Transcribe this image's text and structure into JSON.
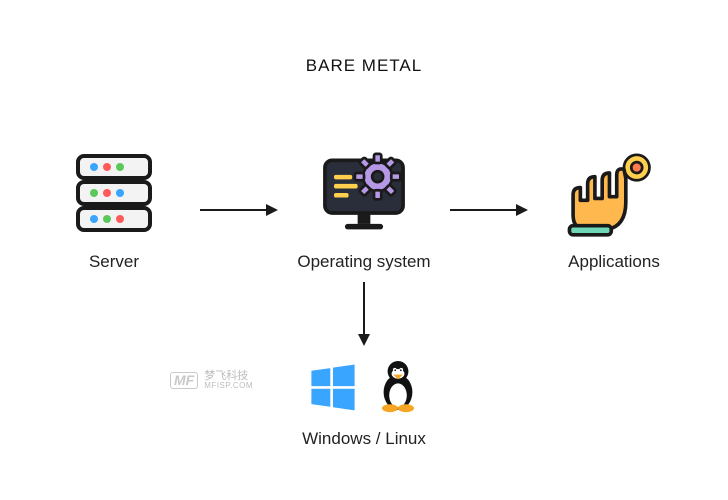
{
  "title": "BARE METAL",
  "nodes": {
    "server": {
      "label": "Server"
    },
    "os": {
      "label": "Operating system"
    },
    "apps": {
      "label": "Applications"
    }
  },
  "os_choices": {
    "label": "Windows / Linux"
  },
  "watermark": {
    "badge": "MF",
    "line1": "梦飞科技",
    "line2": "MFISP.COM"
  },
  "colors": {
    "outline": "#1a1a1a",
    "accent_blue": "#3aa5ff",
    "accent_green": "#5ac85a",
    "accent_red": "#ff5a5a",
    "gear": "#b598e6",
    "screen_fill": "#2a2e3a",
    "hand_fill": "#ffb84d",
    "hand_stroke": "#222",
    "arrow": "#1a1a1a",
    "windows": "#3aa5ff"
  }
}
